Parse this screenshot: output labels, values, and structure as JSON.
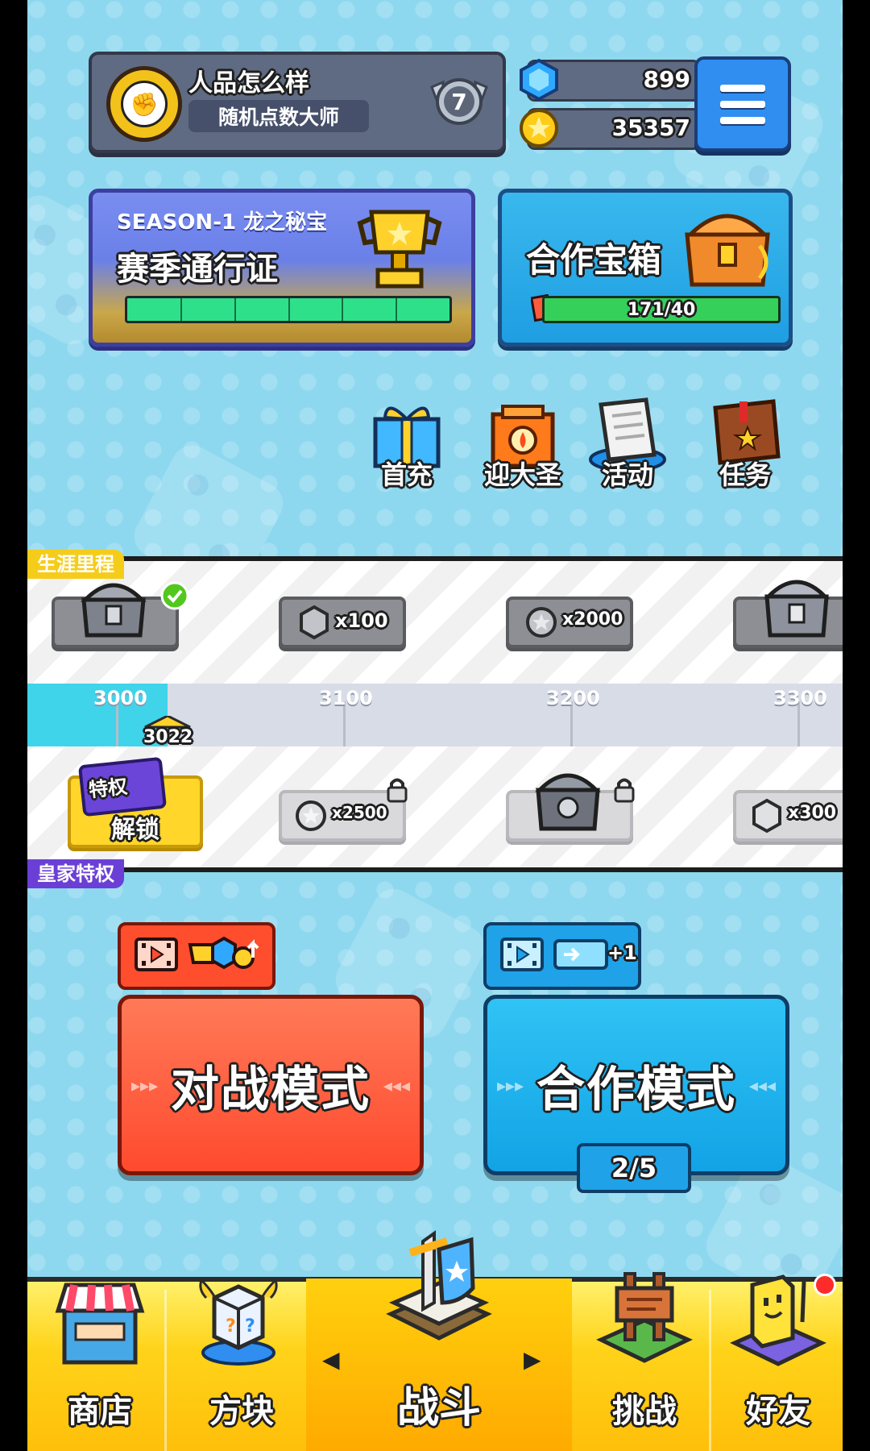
{
  "player": {
    "name": "人品怎么样",
    "title": "随机点数大师",
    "rank": "7"
  },
  "currency": {
    "gems": "899",
    "coins": "35357"
  },
  "menu_icon": "hamburger-menu-icon",
  "season_pass": {
    "subtitle": "SEASON-1 龙之秘宝",
    "title": "赛季通行证",
    "progress_fraction": 1.0
  },
  "coop_chest": {
    "title": "合作宝箱",
    "progress": "171/40"
  },
  "shortcuts": [
    {
      "label": "首充",
      "icon": "gift-box-icon"
    },
    {
      "label": "迎大圣",
      "icon": "shrine-icon"
    },
    {
      "label": "活动",
      "icon": "notice-board-icon"
    },
    {
      "label": "任务",
      "icon": "quest-book-icon"
    }
  ],
  "milestones": {
    "career_label": "生涯里程",
    "royal_label": "皇家特权",
    "current_score": "3022",
    "ticks": [
      "3000",
      "3100",
      "3200",
      "3300"
    ],
    "career_rewards": [
      {
        "type": "chest",
        "amount": "",
        "claimed": true
      },
      {
        "type": "gem",
        "amount": "x100"
      },
      {
        "type": "coin",
        "amount": "x2000"
      },
      {
        "type": "chest",
        "amount": ""
      }
    ],
    "royal_rewards": [
      {
        "type": "coin",
        "amount": "x2500",
        "locked": true
      },
      {
        "type": "chest",
        "amount": "",
        "locked": true
      },
      {
        "type": "gem",
        "amount": "x300",
        "locked": true
      }
    ],
    "privilege_card_label": "特权",
    "unlock_label": "解锁"
  },
  "modes": {
    "battle_label": "对战模式",
    "coop_label": "合作模式",
    "coop_tickets": "2/5",
    "coop_bonus": "+1"
  },
  "nav": [
    {
      "label": "商店",
      "icon": "shop-icon"
    },
    {
      "label": "方块",
      "icon": "mystery-cube-icon"
    },
    {
      "label": "战斗",
      "icon": "sword-shield-icon",
      "active": true
    },
    {
      "label": "挑战",
      "icon": "challenge-signpost-icon"
    },
    {
      "label": "好友",
      "icon": "friends-arcade-icon"
    }
  ],
  "colors": {
    "battle": "#ff5a3c",
    "coop": "#1fb0ee",
    "nav": "#ffd31a",
    "background": "#8ed8ef"
  }
}
